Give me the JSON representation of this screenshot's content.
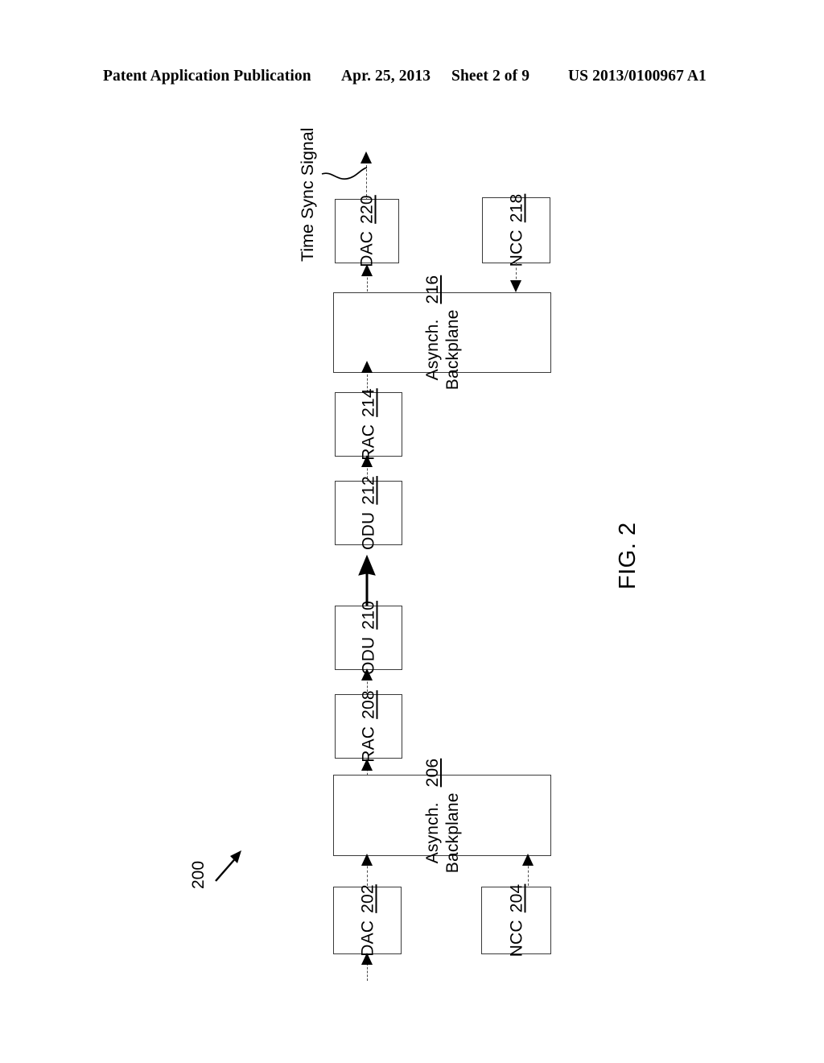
{
  "header": {
    "publication": "Patent Application Publication",
    "date": "Apr. 25, 2013",
    "sheet": "Sheet 2 of 9",
    "doc_number": "US 2013/0100967 A1"
  },
  "figure": {
    "caption": "FIG. 2",
    "reference_numeral": "200",
    "annotation": "Time Sync Signal",
    "blocks": [
      {
        "id": "dac-220",
        "name": "DAC",
        "number": "220"
      },
      {
        "id": "ncc-218",
        "name": "NCC",
        "number": "218"
      },
      {
        "id": "bkpl-216",
        "name": "Asynch. Backplane",
        "name_line1": "Asynch.",
        "name_line2": "Backplane",
        "number": "216"
      },
      {
        "id": "rac-214",
        "name": "RAC",
        "number": "214"
      },
      {
        "id": "odu-212",
        "name": "ODU",
        "number": "212"
      },
      {
        "id": "odu-210",
        "name": "ODU",
        "number": "210"
      },
      {
        "id": "rac-208",
        "name": "RAC",
        "number": "208"
      },
      {
        "id": "bkpl-206",
        "name": "Asynch. Backplane",
        "name_line1": "Asynch.",
        "name_line2": "Backplane",
        "number": "206"
      },
      {
        "id": "dac-202",
        "name": "DAC",
        "number": "202"
      },
      {
        "id": "ncc-204",
        "name": "NCC",
        "number": "204"
      }
    ]
  },
  "colors": {
    "ink": "#000000",
    "box_stroke": "#3a3a3a",
    "connector": "#4a4a4a",
    "page_background": "#ffffff"
  }
}
